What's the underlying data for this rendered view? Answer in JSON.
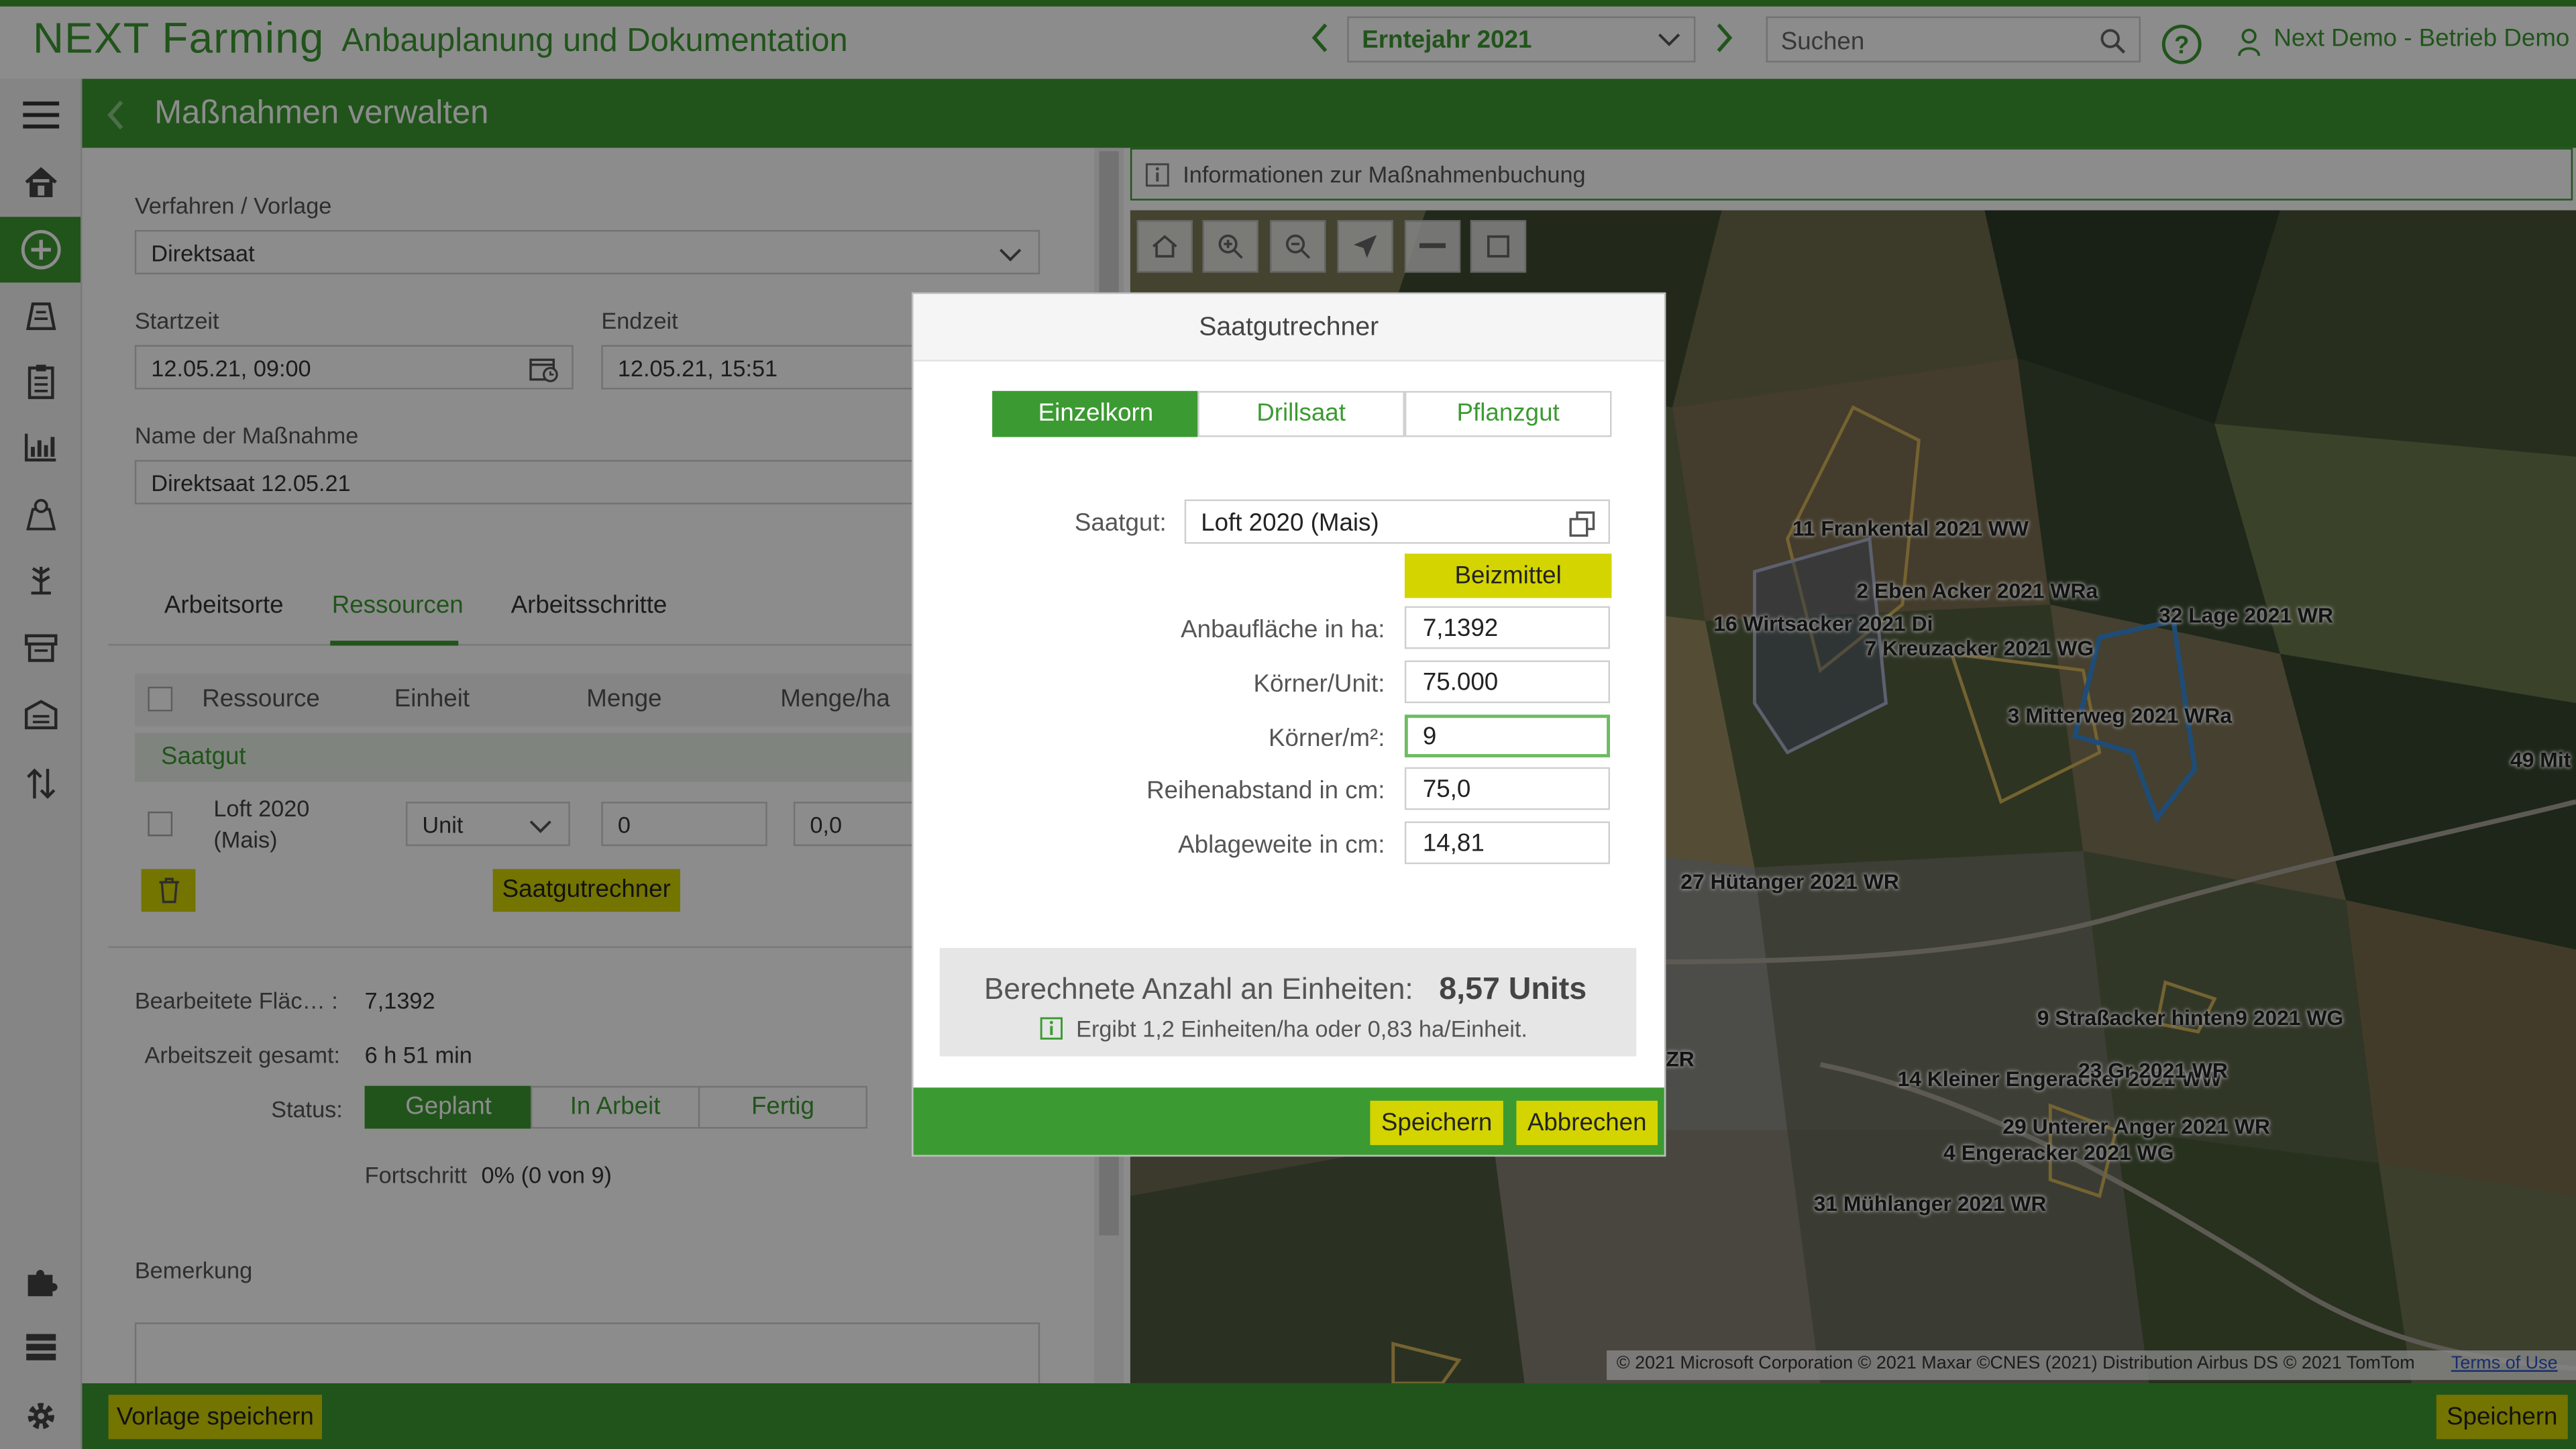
{
  "app": {
    "logo": "NEXT Farming",
    "title": "Anbauplanung und Dokumentation",
    "year": "Erntejahr 2021",
    "search_placeholder": "Suchen",
    "user": "Next Demo - Betrieb Demo"
  },
  "page": {
    "title": "Maßnahmen verwalten"
  },
  "form": {
    "verfahren_label": "Verfahren / Vorlage",
    "verfahren_value": "Direktsaat",
    "start_label": "Startzeit",
    "start_value": "12.05.21, 09:00",
    "end_label": "Endzeit",
    "end_value": "12.05.21, 15:51",
    "name_label": "Name der Maßnahme",
    "name_value": "Direktsaat 12.05.21",
    "tabs": [
      "Arbeitsorte",
      "Ressourcen",
      "Arbeitsschritte"
    ],
    "table_headers": [
      "Ressource",
      "Einheit",
      "Menge",
      "Menge/ha"
    ],
    "group": "Saatgut",
    "row": {
      "name": "Loft 2020 (Mais)",
      "unit": "Unit",
      "amount": "0",
      "per_ha": "0,0"
    },
    "calc_button": "Saatgutrechner",
    "area_label": "Bearbeitete Fläc… :",
    "area_value": "7,1392",
    "time_label": "Arbeitszeit gesamt:",
    "time_value": "6 h 51 min",
    "status_label": "Status:",
    "status_options": [
      "Geplant",
      "In Arbeit",
      "Fertig"
    ],
    "progress_label": "Fortschritt",
    "progress_value": "0% (0 von 9)",
    "remark_label": "Bemerkung"
  },
  "map": {
    "info": "Informationen zur Maßnahmenbuchung",
    "fields": [
      "11 Frankental 2021 WW",
      "2 Eben Acker 2021 WRa",
      "16 Wirtsacker 2021 Di",
      "7 Kreuzacker 2021 WG",
      "32 Lage 2021 WR",
      "3 Mitterweg 2021 WRa",
      "49 Mit",
      "27 Hütanger 2021 WR",
      "9 Straßacker hinten9 2021 WG",
      "14 Kleiner Engeracker 2021 WW",
      "23 Gr 2021 WR",
      "29 Unterer Anger 2021 WR",
      "4 Engeracker 2021 WG",
      "31 Mühlanger 2021 WR",
      "ZR"
    ],
    "copyright": "© 2021 Microsoft Corporation © 2021 Maxar ©CNES (2021) Distribution Airbus DS © 2021 TomTom",
    "terms": "Terms of Use"
  },
  "bottom": {
    "template_save": "Vorlage speichern",
    "save": "Speichern"
  },
  "modal": {
    "title": "Saatgutrechner",
    "tabs": [
      "Einzelkorn",
      "Drillsaat",
      "Pflanzgut"
    ],
    "seed_label": "Saatgut:",
    "seed_value": "Loft 2020 (Mais)",
    "dressing_button": "Beizmittel",
    "rows": [
      {
        "label": "Anbaufläche in ha:",
        "value": "7,1392"
      },
      {
        "label": "Körner/Unit:",
        "value": "75.000"
      },
      {
        "label": "Körner/m²:",
        "value": "9"
      },
      {
        "label": "Reihenabstand in cm:",
        "value": "75,0"
      },
      {
        "label": "Ablageweite in cm:",
        "value": "14,81"
      }
    ],
    "result_label": "Berechnete Anzahl an Einheiten:",
    "result_value": "8,57 Units",
    "result_note": "Ergibt 1,2 Einheiten/ha oder 0,83 ha/Einheit.",
    "save": "Speichern",
    "cancel": "Abbrechen"
  },
  "colors": {
    "brand_green": "#3c9a32",
    "button_yellow": "#d4d400"
  }
}
